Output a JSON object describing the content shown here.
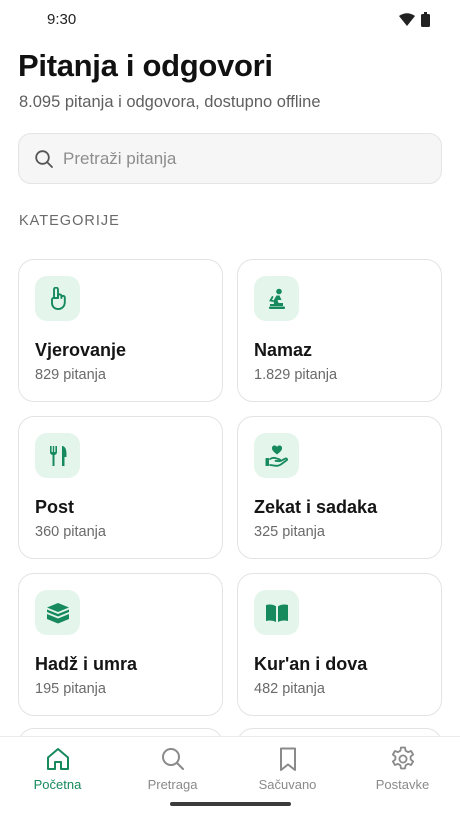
{
  "status_bar": {
    "time": "9:30"
  },
  "header": {
    "title": "Pitanja i odgovori",
    "subtitle": "8.095 pitanja i odgovora, dostupno offline"
  },
  "search": {
    "placeholder": "Pretraži pitanja",
    "value": ""
  },
  "section_label": "KATEGORIJE",
  "categories": [
    {
      "title": "Vjerovanje",
      "count": "829 pitanja",
      "icon": "raised-finger-icon"
    },
    {
      "title": "Namaz",
      "count": "1.829 pitanja",
      "icon": "prayer-icon"
    },
    {
      "title": "Post",
      "count": "360 pitanja",
      "icon": "fork-knife-icon"
    },
    {
      "title": "Zekat i sadaka",
      "count": "325 pitanja",
      "icon": "hand-heart-icon"
    },
    {
      "title": "Hadž i umra",
      "count": "195 pitanja",
      "icon": "kaaba-icon"
    },
    {
      "title": "Kur'an i dova",
      "count": "482 pitanja",
      "icon": "open-book-icon"
    }
  ],
  "bottom_nav": [
    {
      "label": "Početna",
      "icon": "home-icon",
      "active": true
    },
    {
      "label": "Pretraga",
      "icon": "search-icon",
      "active": false
    },
    {
      "label": "Sačuvano",
      "icon": "bookmark-icon",
      "active": false
    },
    {
      "label": "Postavke",
      "icon": "settings-gear-icon",
      "active": false
    }
  ],
  "colors": {
    "accent": "#168a5c",
    "icon_bg": "#e4f5ec",
    "muted": "#8a8a8a"
  }
}
